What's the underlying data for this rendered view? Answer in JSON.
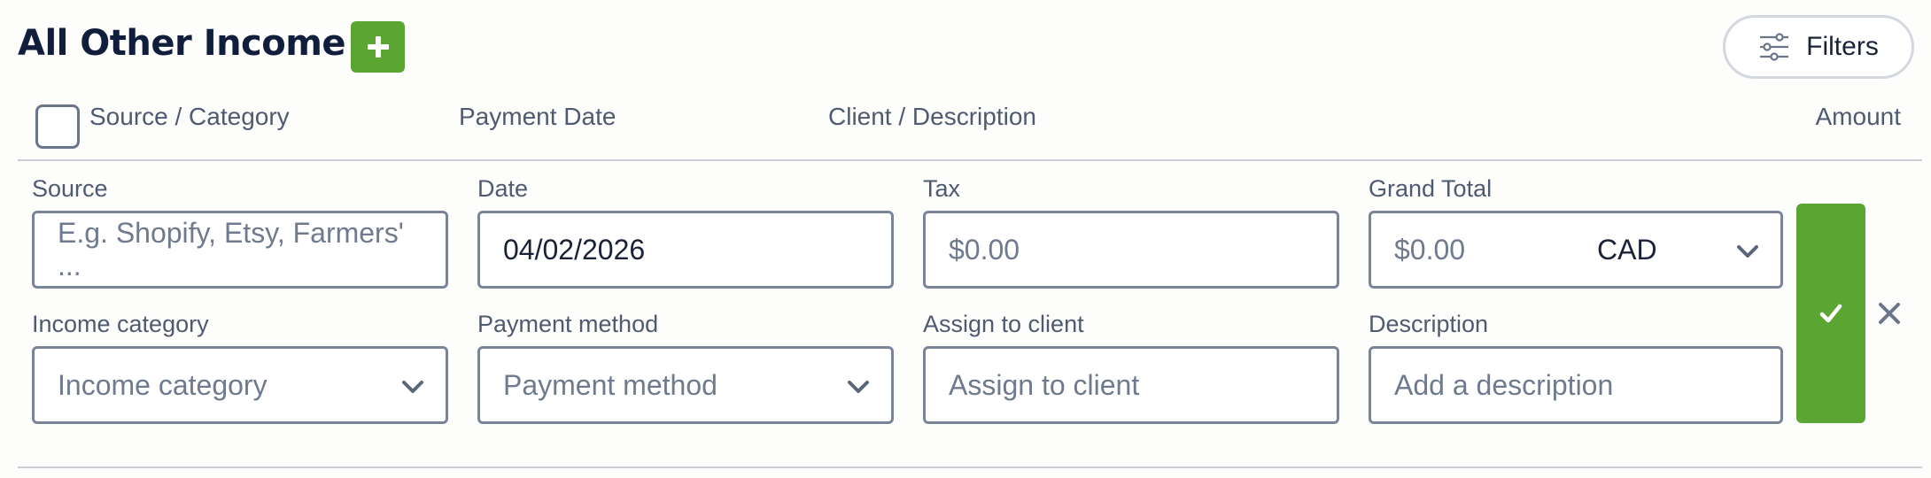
{
  "section": {
    "title": "All Other Income",
    "filters_label": "Filters"
  },
  "columns": {
    "source": "Source / Category",
    "date": "Payment Date",
    "client": "Client / Description",
    "amount": "Amount"
  },
  "form": {
    "source": {
      "label": "Source",
      "placeholder": "E.g. Shopify, Etsy, Farmers' ..."
    },
    "date": {
      "label": "Date",
      "value": "04/02/2026"
    },
    "tax": {
      "label": "Tax",
      "placeholder": "$0.00"
    },
    "grand_total": {
      "label": "Grand Total",
      "placeholder": "$0.00",
      "currency": "CAD"
    },
    "income_category": {
      "label": "Income category",
      "placeholder": "Income category"
    },
    "payment_method": {
      "label": "Payment method",
      "placeholder": "Payment method"
    },
    "assign_client": {
      "label": "Assign to client",
      "placeholder": "Assign to client"
    },
    "description": {
      "label": "Description",
      "placeholder": "Add a description"
    }
  },
  "icons": {
    "add": "plus-icon",
    "filters": "sliders-icon",
    "save": "check-icon",
    "cancel": "close-icon",
    "dropdown": "chevron-down-icon"
  },
  "colors": {
    "accent_green": "#5ba532",
    "title": "#101d3b",
    "border": "#7a8499"
  }
}
